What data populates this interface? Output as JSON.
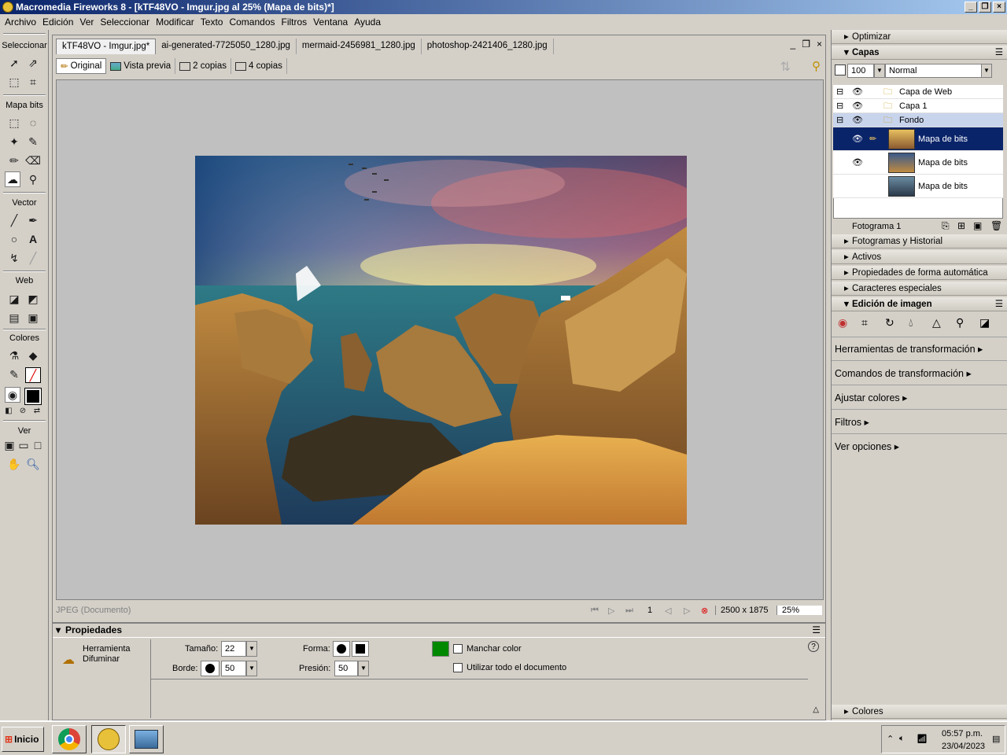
{
  "title": "Macromedia Fireworks 8 - [kTF48VO - Imgur.jpg al 25% (Mapa de bits)*]",
  "menu": [
    "Archivo",
    "Edición",
    "Ver",
    "Seleccionar",
    "Modificar",
    "Texto",
    "Comandos",
    "Filtros",
    "Ventana",
    "Ayuda"
  ],
  "tools": {
    "seleccionar": "Seleccionar",
    "mapa_bits": "Mapa bits",
    "vector": "Vector",
    "web": "Web",
    "colores": "Colores",
    "ver": "Ver"
  },
  "doc": {
    "tabs": [
      "kTF48VO - Imgur.jpg*",
      "ai-generated-7725050_1280.jpg",
      "mermaid-2456981_1280.jpg",
      "photoshop-2421406_1280.jpg"
    ],
    "views": [
      "Original",
      "Vista previa",
      "2 copias",
      "4 copias"
    ],
    "status_left": "JPEG (Documento)",
    "frame": "1",
    "size": "2500 x 1875",
    "zoom": "25%"
  },
  "props": {
    "title": "Propiedades",
    "tool_l1": "Herramienta",
    "tool_l2": "Difuminar",
    "tamano_label": "Tamaño:",
    "tamano": "22",
    "borde_label": "Borde:",
    "borde": "50",
    "forma_label": "Forma:",
    "presion_label": "Presión:",
    "presion": "50",
    "manchar": "Manchar color",
    "utilizar": "Utilizar todo el documento",
    "color": "#008800"
  },
  "panels": {
    "optimizar": "Optimizar",
    "capas": "Capas",
    "opacity": "100",
    "blend": "Normal",
    "layers": [
      "Capa de Web",
      "Capa 1",
      "Fondo"
    ],
    "bitmaps": [
      "Mapa de bits",
      "Mapa de bits",
      "Mapa de bits"
    ],
    "frame": "Fotograma 1",
    "fotogramas": "Fotogramas y Historial",
    "activos": "Activos",
    "propiedades_auto": "Propiedades de forma automática",
    "caracteres": "Caracteres especiales",
    "edicion": "Edición de imagen",
    "links": [
      "Herramientas de transformación",
      "Comandos de transformación",
      "Ajustar colores",
      "Filtros",
      "Ver opciones"
    ],
    "colores": "Colores"
  },
  "taskbar": {
    "start": "Inicio",
    "time": "05:57 p.m.",
    "date": "23/04/2023"
  }
}
